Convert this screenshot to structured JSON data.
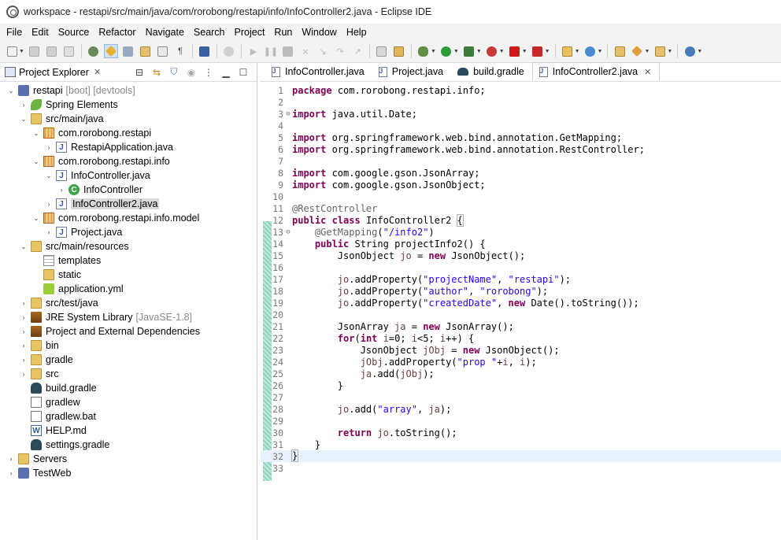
{
  "window": {
    "title": "workspace - restapi/src/main/java/com/rorobong/restapi/info/InfoController2.java - Eclipse IDE"
  },
  "menu": [
    "File",
    "Edit",
    "Source",
    "Refactor",
    "Navigate",
    "Search",
    "Project",
    "Run",
    "Window",
    "Help"
  ],
  "explorer": {
    "title": "Project Explorer",
    "tree": [
      {
        "label": "restapi",
        "decor": "[boot] [devtools]",
        "icon": "project-icon",
        "twisty": "open",
        "indent": 0
      },
      {
        "label": "Spring Elements",
        "decor": "",
        "icon": "spring-icon",
        "twisty": "closed",
        "indent": 1
      },
      {
        "label": "src/main/java",
        "decor": "",
        "icon": "source-folder-icon",
        "twisty": "open",
        "indent": 1
      },
      {
        "label": "com.rorobong.restapi",
        "decor": "",
        "icon": "package-icon",
        "twisty": "open",
        "indent": 2
      },
      {
        "label": "RestapiApplication.java",
        "decor": "",
        "icon": "java-file-icon",
        "twisty": "closed",
        "indent": 3
      },
      {
        "label": "com.rorobong.restapi.info",
        "decor": "",
        "icon": "package-icon",
        "twisty": "open",
        "indent": 2
      },
      {
        "label": "InfoController.java",
        "decor": "",
        "icon": "java-file-icon",
        "twisty": "open",
        "indent": 3
      },
      {
        "label": "InfoController",
        "decor": "",
        "icon": "class-icon",
        "twisty": "closed",
        "indent": 4
      },
      {
        "label": "InfoController2.java",
        "decor": "",
        "icon": "java-file-icon",
        "twisty": "closed",
        "indent": 3,
        "selected": true
      },
      {
        "label": "com.rorobong.restapi.info.model",
        "decor": "",
        "icon": "package-icon",
        "twisty": "open",
        "indent": 2
      },
      {
        "label": "Project.java",
        "decor": "",
        "icon": "java-file-icon",
        "twisty": "closed",
        "indent": 3
      },
      {
        "label": "src/main/resources",
        "decor": "",
        "icon": "source-folder-icon",
        "twisty": "open",
        "indent": 1
      },
      {
        "label": "templates",
        "decor": "",
        "icon": "grid-folder-icon",
        "twisty": "none",
        "indent": 2
      },
      {
        "label": "static",
        "decor": "",
        "icon": "folder-icon",
        "twisty": "none",
        "indent": 2
      },
      {
        "label": "application.yml",
        "decor": "",
        "icon": "yml-file-icon",
        "twisty": "none",
        "indent": 2
      },
      {
        "label": "src/test/java",
        "decor": "",
        "icon": "source-folder-icon",
        "twisty": "closed",
        "indent": 1
      },
      {
        "label": "JRE System Library",
        "decor": "[JavaSE-1.8]",
        "icon": "library-icon",
        "twisty": "closed",
        "indent": 1
      },
      {
        "label": "Project and External Dependencies",
        "decor": "",
        "icon": "library-icon",
        "twisty": "closed",
        "indent": 1
      },
      {
        "label": "bin",
        "decor": "",
        "icon": "folder-icon",
        "twisty": "closed",
        "indent": 1
      },
      {
        "label": "gradle",
        "decor": "",
        "icon": "folder-icon",
        "twisty": "closed",
        "indent": 1
      },
      {
        "label": "src",
        "decor": "",
        "icon": "folder-icon",
        "twisty": "closed",
        "indent": 1
      },
      {
        "label": "build.gradle",
        "decor": "",
        "icon": "gradle-icon",
        "twisty": "none",
        "indent": 1
      },
      {
        "label": "gradlew",
        "decor": "",
        "icon": "file-icon",
        "twisty": "none",
        "indent": 1
      },
      {
        "label": "gradlew.bat",
        "decor": "",
        "icon": "file-icon",
        "twisty": "none",
        "indent": 1
      },
      {
        "label": "HELP.md",
        "decor": "",
        "icon": "markdown-file-icon",
        "twisty": "none",
        "indent": 1
      },
      {
        "label": "settings.gradle",
        "decor": "",
        "icon": "gradle-icon",
        "twisty": "none",
        "indent": 1
      },
      {
        "label": "Servers",
        "decor": "",
        "icon": "folder-icon",
        "twisty": "closed",
        "indent": 0
      },
      {
        "label": "TestWeb",
        "decor": "",
        "icon": "project-icon",
        "twisty": "closed",
        "indent": 0
      }
    ]
  },
  "editor": {
    "tabs": [
      {
        "label": "InfoController.java",
        "icon": "java-file-icon",
        "active": false
      },
      {
        "label": "Project.java",
        "icon": "java-file-icon",
        "active": false
      },
      {
        "label": "build.gradle",
        "icon": "gradle-icon",
        "active": false
      },
      {
        "label": "InfoController2.java",
        "icon": "java-file-icon",
        "active": true
      }
    ],
    "close_glyph": "✕",
    "lines": [
      {
        "n": "1",
        "t": "package com.rorobong.restapi.info;"
      },
      {
        "n": "2",
        "t": ""
      },
      {
        "n": "3",
        "t": "import java.util.Date;",
        "fold": "⊖"
      },
      {
        "n": "4",
        "t": ""
      },
      {
        "n": "5",
        "t": "import org.springframework.web.bind.annotation.GetMapping;"
      },
      {
        "n": "6",
        "t": "import org.springframework.web.bind.annotation.RestController;"
      },
      {
        "n": "7",
        "t": ""
      },
      {
        "n": "8",
        "t": "import com.google.gson.JsonArray;"
      },
      {
        "n": "9",
        "t": "import com.google.gson.JsonObject;"
      },
      {
        "n": "10",
        "t": ""
      },
      {
        "n": "11",
        "t": "@RestController"
      },
      {
        "n": "12",
        "t": "public class InfoController2 {"
      },
      {
        "n": "13",
        "t": "    @GetMapping(\"/info2\")",
        "fold": "⊖"
      },
      {
        "n": "14",
        "t": "    public String projectInfo2() {"
      },
      {
        "n": "15",
        "t": "        JsonObject jo = new JsonObject();"
      },
      {
        "n": "16",
        "t": ""
      },
      {
        "n": "17",
        "t": "        jo.addProperty(\"projectName\", \"restapi\");"
      },
      {
        "n": "18",
        "t": "        jo.addProperty(\"author\", \"rorobong\");"
      },
      {
        "n": "19",
        "t": "        jo.addProperty(\"createdDate\", new Date().toString());"
      },
      {
        "n": "20",
        "t": ""
      },
      {
        "n": "21",
        "t": "        JsonArray ja = new JsonArray();"
      },
      {
        "n": "22",
        "t": "        for(int i=0; i<5; i++) {"
      },
      {
        "n": "23",
        "t": "            JsonObject jObj = new JsonObject();"
      },
      {
        "n": "24",
        "t": "            jObj.addProperty(\"prop \"+i, i);"
      },
      {
        "n": "25",
        "t": "            ja.add(jObj);"
      },
      {
        "n": "26",
        "t": "        }"
      },
      {
        "n": "27",
        "t": ""
      },
      {
        "n": "28",
        "t": "        jo.add(\"array\", ja);"
      },
      {
        "n": "29",
        "t": ""
      },
      {
        "n": "30",
        "t": "        return jo.toString();"
      },
      {
        "n": "31",
        "t": "    }"
      },
      {
        "n": "32",
        "t": "}",
        "current": true
      },
      {
        "n": "33",
        "t": ""
      }
    ]
  },
  "colors": {
    "keyword": "#7f0055",
    "string": "#2a00ff",
    "annotation": "#646464",
    "local_variable": "#6a3e3e",
    "current_line": "#e8f2fe"
  }
}
